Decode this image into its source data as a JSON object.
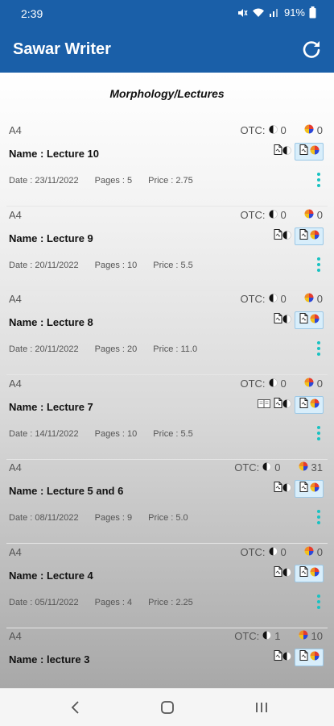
{
  "status": {
    "time": "2:39",
    "battery": "91%"
  },
  "app": {
    "title": "Sawar Writer"
  },
  "page": {
    "heading": "Morphology/Lectures"
  },
  "labels": {
    "otc": "OTC:"
  },
  "colors": {
    "primary": "#1a5fa8",
    "accent": "#19c2c2"
  },
  "icons": {
    "refresh": "refresh-icon",
    "bw": "black-white-print-icon",
    "color": "color-print-icon",
    "doc": "document-icon",
    "more": "more-vertical-icon",
    "booklet": "booklet-icon"
  },
  "lectures": [
    {
      "paper": "A4",
      "otc_bw": "0",
      "otc_color": "0",
      "name": "Name : Lecture 10",
      "date": "Date : 23/11/2022",
      "pages": "Pages : 5",
      "price": "Price : 2.75",
      "booklet": false
    },
    {
      "paper": "A4",
      "otc_bw": "0",
      "otc_color": "0",
      "name": "Name : Lecture 9",
      "date": "Date : 20/11/2022",
      "pages": "Pages : 10",
      "price": "Price : 5.5",
      "booklet": false
    },
    {
      "paper": "A4",
      "otc_bw": "0",
      "otc_color": "0",
      "name": "Name : Lecture 8",
      "date": "Date : 20/11/2022",
      "pages": "Pages : 20",
      "price": "Price : 11.0",
      "booklet": false
    },
    {
      "paper": "A4",
      "otc_bw": "0",
      "otc_color": "0",
      "name": "Name : Lecture 7",
      "date": "Date : 14/11/2022",
      "pages": "Pages : 10",
      "price": "Price : 5.5",
      "booklet": true
    },
    {
      "paper": "A4",
      "otc_bw": "0",
      "otc_color": "31",
      "name": "Name : Lecture 5 and 6",
      "date": "Date : 08/11/2022",
      "pages": "Pages : 9",
      "price": "Price : 5.0",
      "booklet": false
    },
    {
      "paper": "A4",
      "otc_bw": "0",
      "otc_color": "0",
      "name": "Name : Lecture 4",
      "date": "Date : 05/11/2022",
      "pages": "Pages : 4",
      "price": "Price : 2.25",
      "booklet": false
    },
    {
      "paper": "A4",
      "otc_bw": "1",
      "otc_color": "10",
      "name": "Name : lecture 3",
      "date": "",
      "pages": "",
      "price": "",
      "booklet": false
    }
  ]
}
